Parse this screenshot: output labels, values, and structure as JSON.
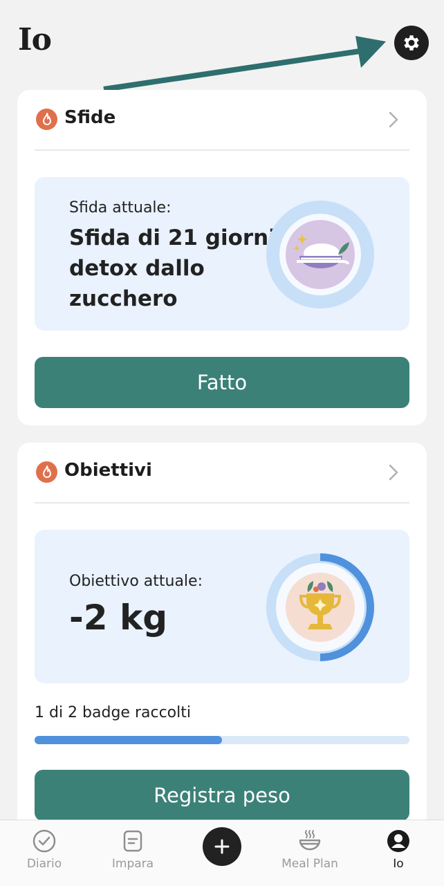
{
  "header": {
    "title": "Io"
  },
  "challenges": {
    "title": "Sfide",
    "current_label": "Sfida attuale:",
    "current_name_lines": [
      "Sfida di 21 giorni",
      "detox dallo",
      "zucchero"
    ],
    "action_label": "Fatto"
  },
  "goals": {
    "title": "Obiettivi",
    "current_label": "Obiettivo attuale:",
    "current_value": "-2 kg",
    "badges_text": "1 di 2 badge raccolti",
    "badges_progress": 0.5,
    "action_label": "Registra peso"
  },
  "nav": {
    "items": [
      {
        "label": "Diario",
        "icon": "check-circle-icon"
      },
      {
        "label": "Impara",
        "icon": "document-icon"
      },
      {
        "label": "",
        "icon": "plus-icon"
      },
      {
        "label": "Meal Plan",
        "icon": "bowl-icon"
      },
      {
        "label": "Io",
        "icon": "user-icon"
      }
    ]
  },
  "colors": {
    "accent_green": "#3c8178",
    "flame": "#e0704b",
    "progress": "#4f91dc",
    "panel_bg": "#e9f2fd",
    "arrow": "#2e6e6e"
  }
}
